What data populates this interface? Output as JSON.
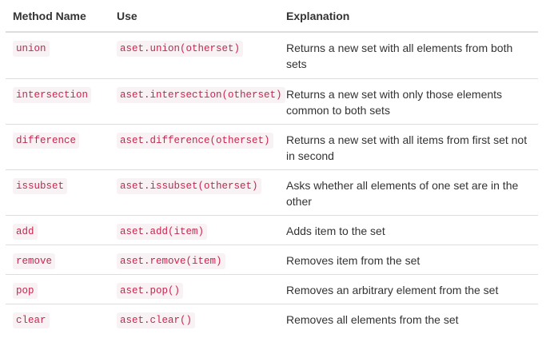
{
  "headers": {
    "method": "Method Name",
    "use": "Use",
    "explanation": "Explanation"
  },
  "rows": [
    {
      "method": "union",
      "use": "aset.union(otherset)",
      "explanation": "Returns a new set with all elements from both sets"
    },
    {
      "method": "intersection",
      "use": "aset.intersection(otherset)",
      "explanation": "Returns a new set with only those elements common to both sets"
    },
    {
      "method": "difference",
      "use": "aset.difference(otherset)",
      "explanation": "Returns a new set with all items from first set not in second"
    },
    {
      "method": "issubset",
      "use": "aset.issubset(otherset)",
      "explanation": "Asks whether all elements of one set are in the other"
    },
    {
      "method": "add",
      "use": "aset.add(item)",
      "explanation": "Adds item to the set"
    },
    {
      "method": "remove",
      "use": "aset.remove(item)",
      "explanation": "Removes item from the set"
    },
    {
      "method": "pop",
      "use": "aset.pop()",
      "explanation": "Removes an arbitrary element from the set"
    },
    {
      "method": "clear",
      "use": "aset.clear()",
      "explanation": "Removes all elements from the set"
    }
  ]
}
